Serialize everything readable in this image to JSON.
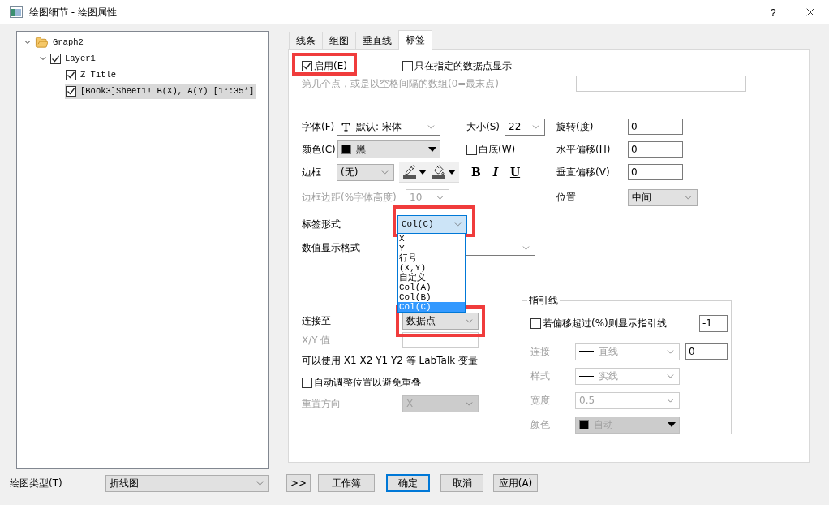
{
  "window": {
    "title": "绘图细节 - 绘图属性",
    "help": "?"
  },
  "tree": [
    {
      "label": "Graph2",
      "kind": "folder",
      "expanded": true,
      "selected": false,
      "children": [
        {
          "label": "Layer1",
          "expanded": true,
          "checked": true,
          "selected": false,
          "children": [
            {
              "label": "Z Title",
              "checked": true,
              "selected": false
            },
            {
              "label": "[Book3]Sheet1! B(X), A(Y) [1*:35*]",
              "checked": true,
              "selected": true
            }
          ]
        }
      ]
    }
  ],
  "tabs": [
    {
      "label": "线条",
      "selected": false
    },
    {
      "label": "组图",
      "selected": false
    },
    {
      "label": "垂直线",
      "selected": false
    },
    {
      "label": "标签",
      "selected": true
    }
  ],
  "label_tab": {
    "enable": {
      "label": "启用(E)",
      "checked": true,
      "highlighted": true
    },
    "only_specified": {
      "label": "只在指定的数据点显示",
      "checked": false
    },
    "points_field": {
      "label": "第几个点，或是以空格间隔的数组(0=最末点)",
      "disabled": true
    },
    "font": {
      "label": "字体(F)",
      "value": "默认: 宋体"
    },
    "size": {
      "label": "大小(S)",
      "value": "22"
    },
    "rotation": {
      "label": "旋转(度)",
      "value": "0"
    },
    "color": {
      "label": "颜色(C)",
      "value": "黑"
    },
    "white_bg": {
      "label": "白底(W)",
      "checked": false
    },
    "h_offset": {
      "label": "水平偏移(H)",
      "value": "0"
    },
    "border": {
      "label": "边框",
      "value": "(无)"
    },
    "style_buttons": [
      {
        "label": "B",
        "kind": "bold"
      },
      {
        "label": "I",
        "kind": "italic"
      },
      {
        "label": "U",
        "kind": "underline"
      }
    ],
    "v_offset": {
      "label": "垂直偏移(V)",
      "value": "0"
    },
    "border_margin": {
      "label": "边框边距(%字体高度)",
      "value": "10",
      "disabled": true
    },
    "position": {
      "label": "位置",
      "value": "中间"
    },
    "label_form": {
      "label": "标签形式",
      "value": "Col(C)",
      "highlighted": true,
      "expanded": true,
      "options": [
        {
          "label": "X",
          "selected": false
        },
        {
          "label": "Y",
          "selected": false
        },
        {
          "label": "行号",
          "selected": false
        },
        {
          "label": "(X,Y)",
          "selected": false
        },
        {
          "label": "自定义",
          "selected": false
        },
        {
          "label": "Col(A)",
          "selected": false
        },
        {
          "label": "Col(B)",
          "selected": false
        },
        {
          "label": "Col(C)",
          "selected": true
        }
      ]
    },
    "number_format": {
      "label": "数值显示格式"
    },
    "connect_to": {
      "label": "连接至",
      "value": "数据点",
      "highlighted": true
    },
    "xy_value": {
      "label": "X/Y 值",
      "disabled": true
    },
    "hint": "可以使用 X1 X2 Y1 Y2 等 LabTalk 变量",
    "auto_adjust": {
      "label": "自动调整位置以避免重叠",
      "checked": false
    },
    "reset_direction": {
      "label": "重置方向",
      "value": "X",
      "disabled": true
    }
  },
  "leader": {
    "title": "指引线",
    "show": {
      "label": "若偏移超过(%)则显示指引线",
      "checked": false,
      "value": "-1"
    },
    "rows": [
      {
        "kind": "line",
        "label": "连接",
        "value": "直线",
        "extra": "0",
        "disabled": true
      },
      {
        "kind": "line",
        "label": "样式",
        "value": "实线",
        "disabled": true
      },
      {
        "kind": "plain",
        "label": "宽度",
        "value": "0.5",
        "disabled": true
      },
      {
        "kind": "color",
        "label": "颜色",
        "value": "自动",
        "disabled": true
      }
    ]
  },
  "bottom": {
    "plot_type": {
      "label": "绘图类型(T)",
      "value": "折线图"
    },
    "buttons": [
      {
        "label": ">>",
        "default": false
      },
      {
        "label": "工作簿",
        "default": false
      },
      {
        "label": "确定",
        "default": true
      },
      {
        "label": "取消",
        "default": false
      },
      {
        "label": "应用(A)",
        "default": false
      }
    ]
  }
}
